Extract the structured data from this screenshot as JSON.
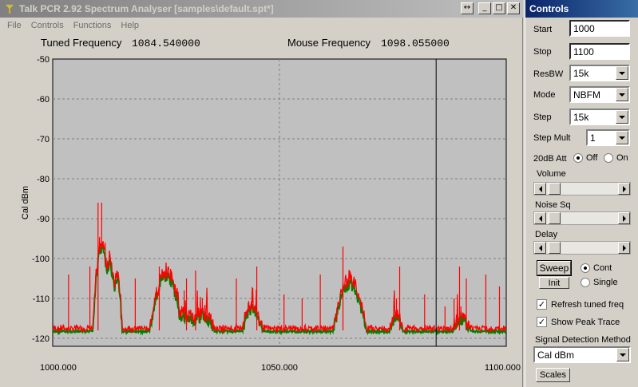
{
  "main_window": {
    "title": "Talk PCR 2.92 Spectrum Analyser [samples\\default.spt*]",
    "menu": [
      "File",
      "Controls",
      "Functions",
      "Help"
    ]
  },
  "readouts": {
    "tuned_label": "Tuned Frequency",
    "tuned_value": "1084.540000",
    "mouse_label": "Mouse Frequency",
    "mouse_value": "1098.055000"
  },
  "controls": {
    "title": "Controls",
    "start_label": "Start",
    "start_value": "1000",
    "stop_label": "Stop",
    "stop_value": "1100",
    "resbw_label": "ResBW",
    "resbw_value": "15k",
    "mode_label": "Mode",
    "mode_value": "NBFM",
    "step_label": "Step",
    "step_value": "15k",
    "stepmult_label": "Step Mult",
    "stepmult_value": "1",
    "att_label": "20dB Att",
    "att_off": "Off",
    "att_on": "On",
    "att_selected": "Off",
    "volume_label": "Volume",
    "volume_level": 0.04,
    "noise_label": "Noise Sq",
    "noise_level": 0.04,
    "delay_label": "Delay",
    "delay_level": 0.04,
    "sweep_label": "Sweep",
    "init_label": "Init",
    "cont_label": "Cont",
    "single_label": "Single",
    "sweep_mode_selected": "Cont",
    "refresh_label": "Refresh tuned freq",
    "refresh_checked": true,
    "peak_label": "Show Peak Trace",
    "peak_checked": true,
    "sdm_label": "Signal Detection Method",
    "sdm_value": "Cal dBm",
    "scales_label": "Scales"
  },
  "chart_data": {
    "type": "line",
    "ylabel": "Cal dBm",
    "xlim": [
      1000,
      1100
    ],
    "ylim": [
      -122,
      -50
    ],
    "y_ticks": [
      -50,
      -60,
      -70,
      -80,
      -90,
      -100,
      -110,
      -120
    ],
    "y_tick_labels": [
      "-50",
      "-60",
      "-70",
      "-80",
      "-90",
      "-100",
      "-110",
      "-120"
    ],
    "x_ticks": [
      1000,
      1050,
      1100
    ],
    "x_tick_labels": [
      "1000.000",
      "1050.000",
      "1100.000"
    ],
    "grid": true,
    "cursor_x": 1084.54,
    "colors": {
      "peak": "#ff0000",
      "live": "#008000",
      "background": "#c0c0c0",
      "grid": "#808080"
    },
    "noise_floor": -118,
    "signals": [
      {
        "x": 1010.8,
        "width": 1.4,
        "peak": -96,
        "spike": -86
      },
      {
        "x": 1012.5,
        "width": 1.2,
        "peak": -100,
        "spike": -98
      },
      {
        "x": 1014.2,
        "width": 0.8,
        "peak": -104,
        "spike": -103
      },
      {
        "x": 1025.0,
        "width": 2.5,
        "peak": -103,
        "spike": -101
      },
      {
        "x": 1029.0,
        "width": 3.0,
        "peak": -113,
        "spike": -108
      },
      {
        "x": 1033.0,
        "width": 2.0,
        "peak": -113,
        "spike": -110
      },
      {
        "x": 1044.0,
        "width": 1.6,
        "peak": -111,
        "spike": -108
      },
      {
        "x": 1065.5,
        "width": 2.5,
        "peak": -105,
        "spike": -103
      },
      {
        "x": 1075.8,
        "width": 1.0,
        "peak": -113,
        "spike": -110
      },
      {
        "x": 1090.0,
        "width": 1.5,
        "peak": -114,
        "spike": -112
      }
    ],
    "spikes": [
      {
        "x": 1003.5,
        "y": -104
      },
      {
        "x": 1008.2,
        "y": -102
      },
      {
        "x": 1010.0,
        "y": -86
      },
      {
        "x": 1018.2,
        "y": -105
      },
      {
        "x": 1023.5,
        "y": -102
      },
      {
        "x": 1029.5,
        "y": -105
      },
      {
        "x": 1031.5,
        "y": -103
      },
      {
        "x": 1040.5,
        "y": -105
      },
      {
        "x": 1045.0,
        "y": -102
      },
      {
        "x": 1051.0,
        "y": -109
      },
      {
        "x": 1055.0,
        "y": -110
      },
      {
        "x": 1059.0,
        "y": -104
      },
      {
        "x": 1064.0,
        "y": -97
      },
      {
        "x": 1076.5,
        "y": -102
      },
      {
        "x": 1082.0,
        "y": -109
      },
      {
        "x": 1086.5,
        "y": -112
      },
      {
        "x": 1088.5,
        "y": -110
      },
      {
        "x": 1089.7,
        "y": -102
      },
      {
        "x": 1091.2,
        "y": -105
      },
      {
        "x": 1095.5,
        "y": -104
      },
      {
        "x": 1098.5,
        "y": -107
      }
    ]
  }
}
